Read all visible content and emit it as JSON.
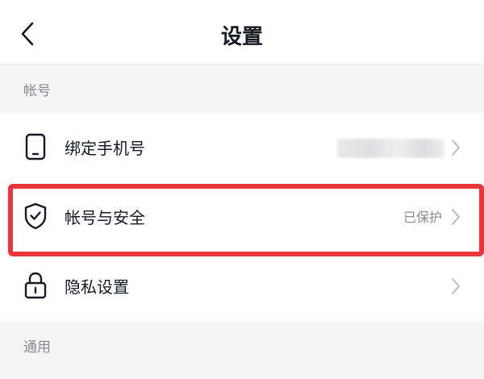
{
  "header": {
    "title": "设置",
    "back_icon": "chevron-left-icon"
  },
  "sections": [
    {
      "title": "帐号",
      "items": [
        {
          "icon": "phone-icon",
          "label": "绑定手机号",
          "value": ""
        },
        {
          "icon": "shield-check-icon",
          "label": "帐号与安全",
          "value": "已保护"
        },
        {
          "icon": "lock-icon",
          "label": "隐私设置",
          "value": ""
        }
      ]
    },
    {
      "title": "通用",
      "items": []
    }
  ],
  "colors": {
    "background": "#f5f5f5",
    "row_background": "#ffffff",
    "text_primary": "#161823",
    "text_secondary": "#8a8b91",
    "highlight": "#e8363c"
  }
}
